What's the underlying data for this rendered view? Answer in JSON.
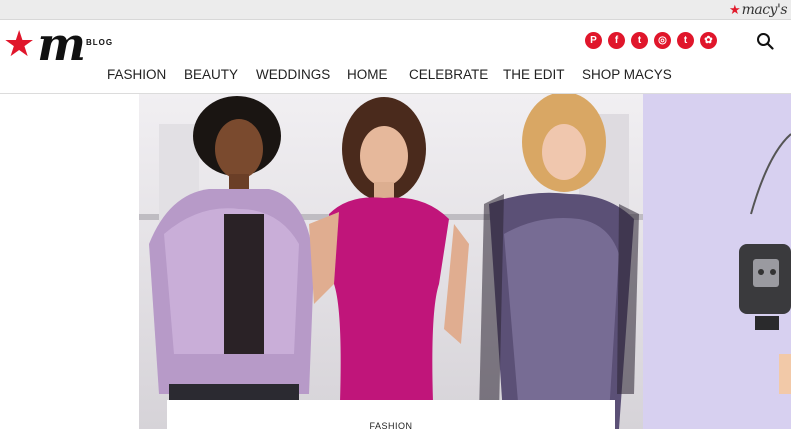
{
  "topbar": {
    "macys_logo_text": "macy's"
  },
  "header": {
    "brand_mark": "m",
    "brand_sub": "BLOG",
    "social": [
      {
        "name": "pinterest",
        "glyph": "P"
      },
      {
        "name": "facebook",
        "glyph": "f"
      },
      {
        "name": "twitter",
        "glyph": "t"
      },
      {
        "name": "instagram",
        "glyph": "◎"
      },
      {
        "name": "tumblr",
        "glyph": "t"
      },
      {
        "name": "snapchat",
        "glyph": "✿"
      }
    ],
    "accent_color": "#e0162b"
  },
  "nav": {
    "items": [
      "FASHION",
      "BEAUTY",
      "WEDDINGS",
      "HOME",
      "CELEBRATE",
      "THE EDIT",
      "SHOP MACYS"
    ]
  },
  "feature": {
    "category_label": "FASHION"
  },
  "colors": {
    "side_panel": "#d7d0f0",
    "dress_magenta": "#c0157a"
  }
}
